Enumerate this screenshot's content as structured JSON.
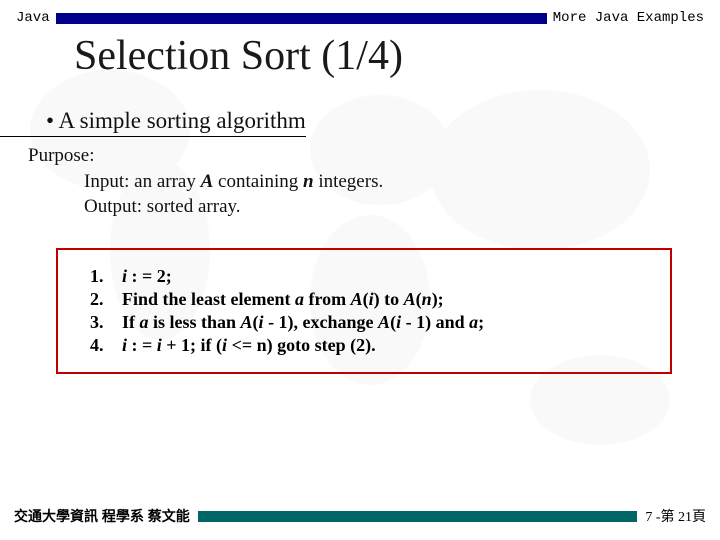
{
  "header": {
    "left": "Java",
    "right": "More Java Examples"
  },
  "title": "Selection Sort (1/4)",
  "bullet": "•   A simple sorting algorithm",
  "purpose": {
    "label": "Purpose:",
    "input_prefix": "Input: an array ",
    "input_A": "A",
    "input_mid": " containing ",
    "input_n": "n",
    "input_suffix": " integers.",
    "output": "Output: sorted array."
  },
  "algorithm": {
    "steps": [
      {
        "num": "1.",
        "html": "<em class='i'>i</em> : = 2;"
      },
      {
        "num": "2.",
        "html": "Find the least element <em class='i'>a</em> from <em class='i'>A</em>(<em class='i'>i</em>) to <em class='i'>A</em>(<em class='i'>n</em>);"
      },
      {
        "num": "3.",
        "html": "If <em class='i'>a</em> is less than <em class='i'>A</em>(<em class='i'>i</em> - 1), exchange <em class='i'>A</em>(<em class='i'>i</em> - 1) and <em class='i'>a</em>;"
      },
      {
        "num": "4.",
        "html": " <em class='i'>i</em> : = <em class='i'>i</em> + 1; if  (<em class='i'>i</em> <= n) goto step (2)."
      }
    ]
  },
  "footer": {
    "left": "交通大學資訊 程學系 蔡文能",
    "right": "7 -第 21頁"
  }
}
